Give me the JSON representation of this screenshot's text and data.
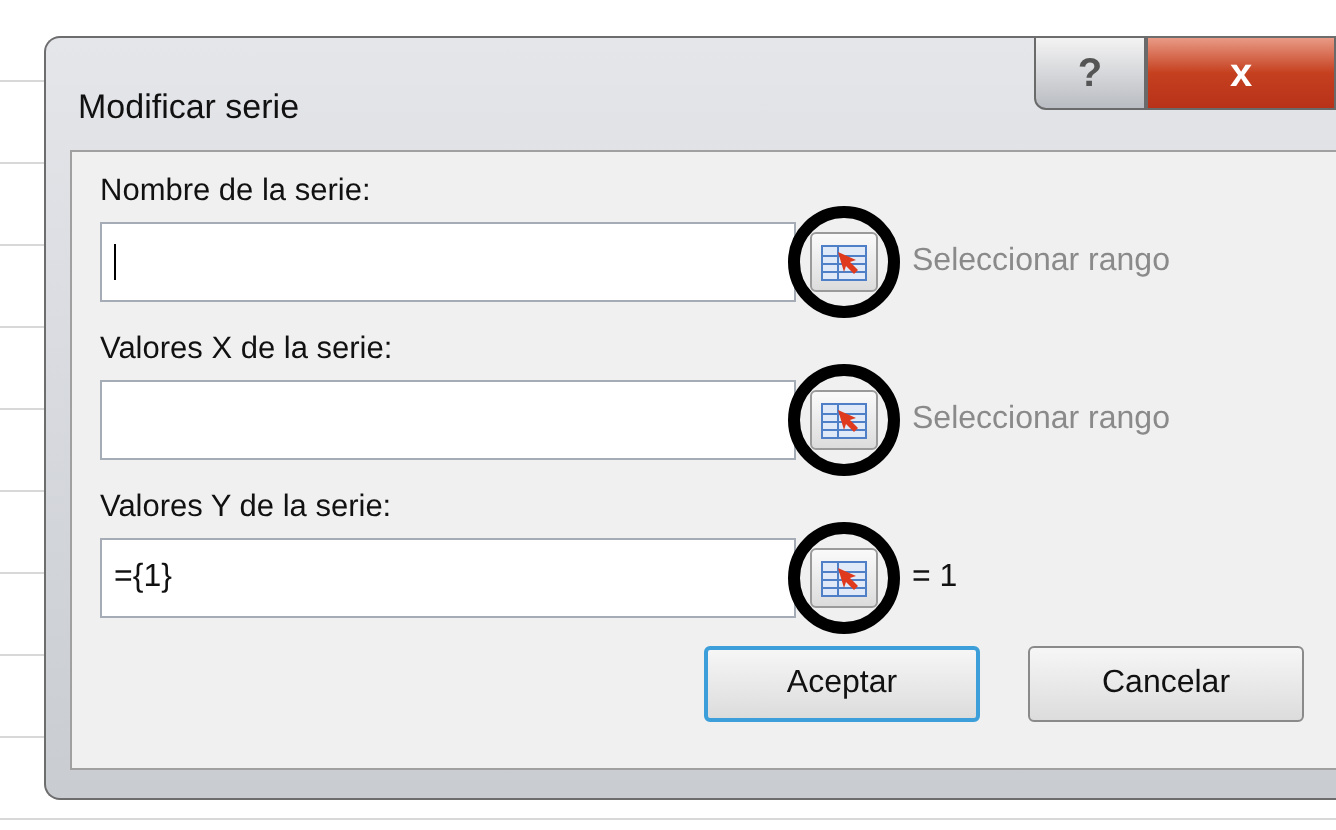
{
  "window": {
    "title": "Modificar serie",
    "title_buttons": [
      {
        "kind": "help",
        "label": "?"
      },
      {
        "kind": "close",
        "label": "x"
      }
    ]
  },
  "fields": [
    {
      "label": "Nombre de la serie:",
      "focused": true,
      "preview": "Seleccionar rango",
      "preview_muted": true,
      "highlighted": true
    },
    {
      "label": "Valores X de la serie:",
      "focused": false,
      "preview": "Seleccionar rango",
      "preview_muted": true,
      "highlighted": true
    },
    {
      "label": "Valores Y de la serie:",
      "value": "={1}",
      "focused": false,
      "preview": "= 1",
      "preview_muted": false,
      "highlighted": true
    }
  ],
  "buttons": [
    {
      "label": "Aceptar",
      "default": true
    },
    {
      "label": "Cancelar",
      "default": false
    }
  ]
}
